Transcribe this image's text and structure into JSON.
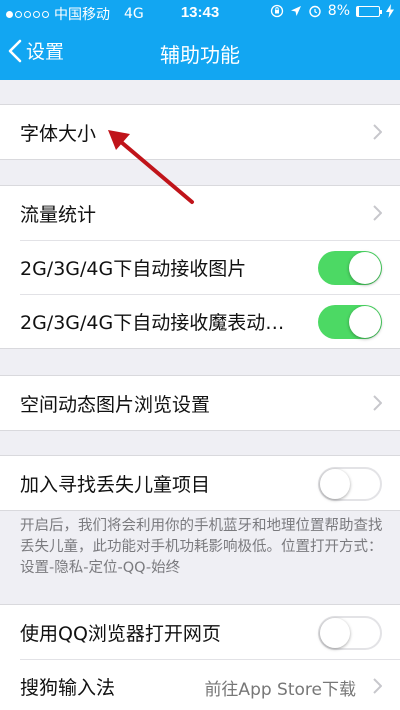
{
  "status_bar": {
    "carrier": "中国移动",
    "network": "4G",
    "time": "13:43",
    "battery_percent_label": "8%",
    "battery_level": 0.08,
    "signal_bars_filled": 1
  },
  "nav": {
    "back_label": "设置",
    "title": "辅助功能"
  },
  "groups": [
    {
      "rows": [
        {
          "label": "字体大小",
          "control": "chevron"
        }
      ]
    },
    {
      "rows": [
        {
          "label": "流量统计",
          "control": "chevron"
        },
        {
          "label": "2G/3G/4G下自动接收图片",
          "control": "toggle",
          "on": true
        },
        {
          "label": "2G/3G/4G下自动接收魔表动…",
          "control": "toggle",
          "on": true
        }
      ]
    },
    {
      "rows": [
        {
          "label": "空间动态图片浏览设置",
          "control": "chevron"
        }
      ]
    },
    {
      "rows": [
        {
          "label": "加入寻找丢失儿童项目",
          "control": "toggle",
          "on": false
        }
      ]
    },
    {
      "rows": [
        {
          "label": "使用QQ浏览器打开网页",
          "control": "toggle",
          "on": false
        },
        {
          "label": "搜狗输入法",
          "control": "chevron",
          "value": "前往App Store下载"
        }
      ]
    }
  ],
  "footnote": "开启后，我们将会利用你的手机蓝牙和地理位置帮助查找丢失儿童，此功能对手机功耗影响极低。位置打开方式：设置-隐私-定位-QQ-始终",
  "colors": {
    "accent": "#12a6f2",
    "toggle_on": "#4cd964",
    "annotation_arrow": "#c0141a"
  },
  "icons": [
    "chevron-left-icon",
    "chevron-right-icon",
    "lock-rotation-icon",
    "location-icon",
    "alarm-icon",
    "battery-icon",
    "charging-icon"
  ]
}
